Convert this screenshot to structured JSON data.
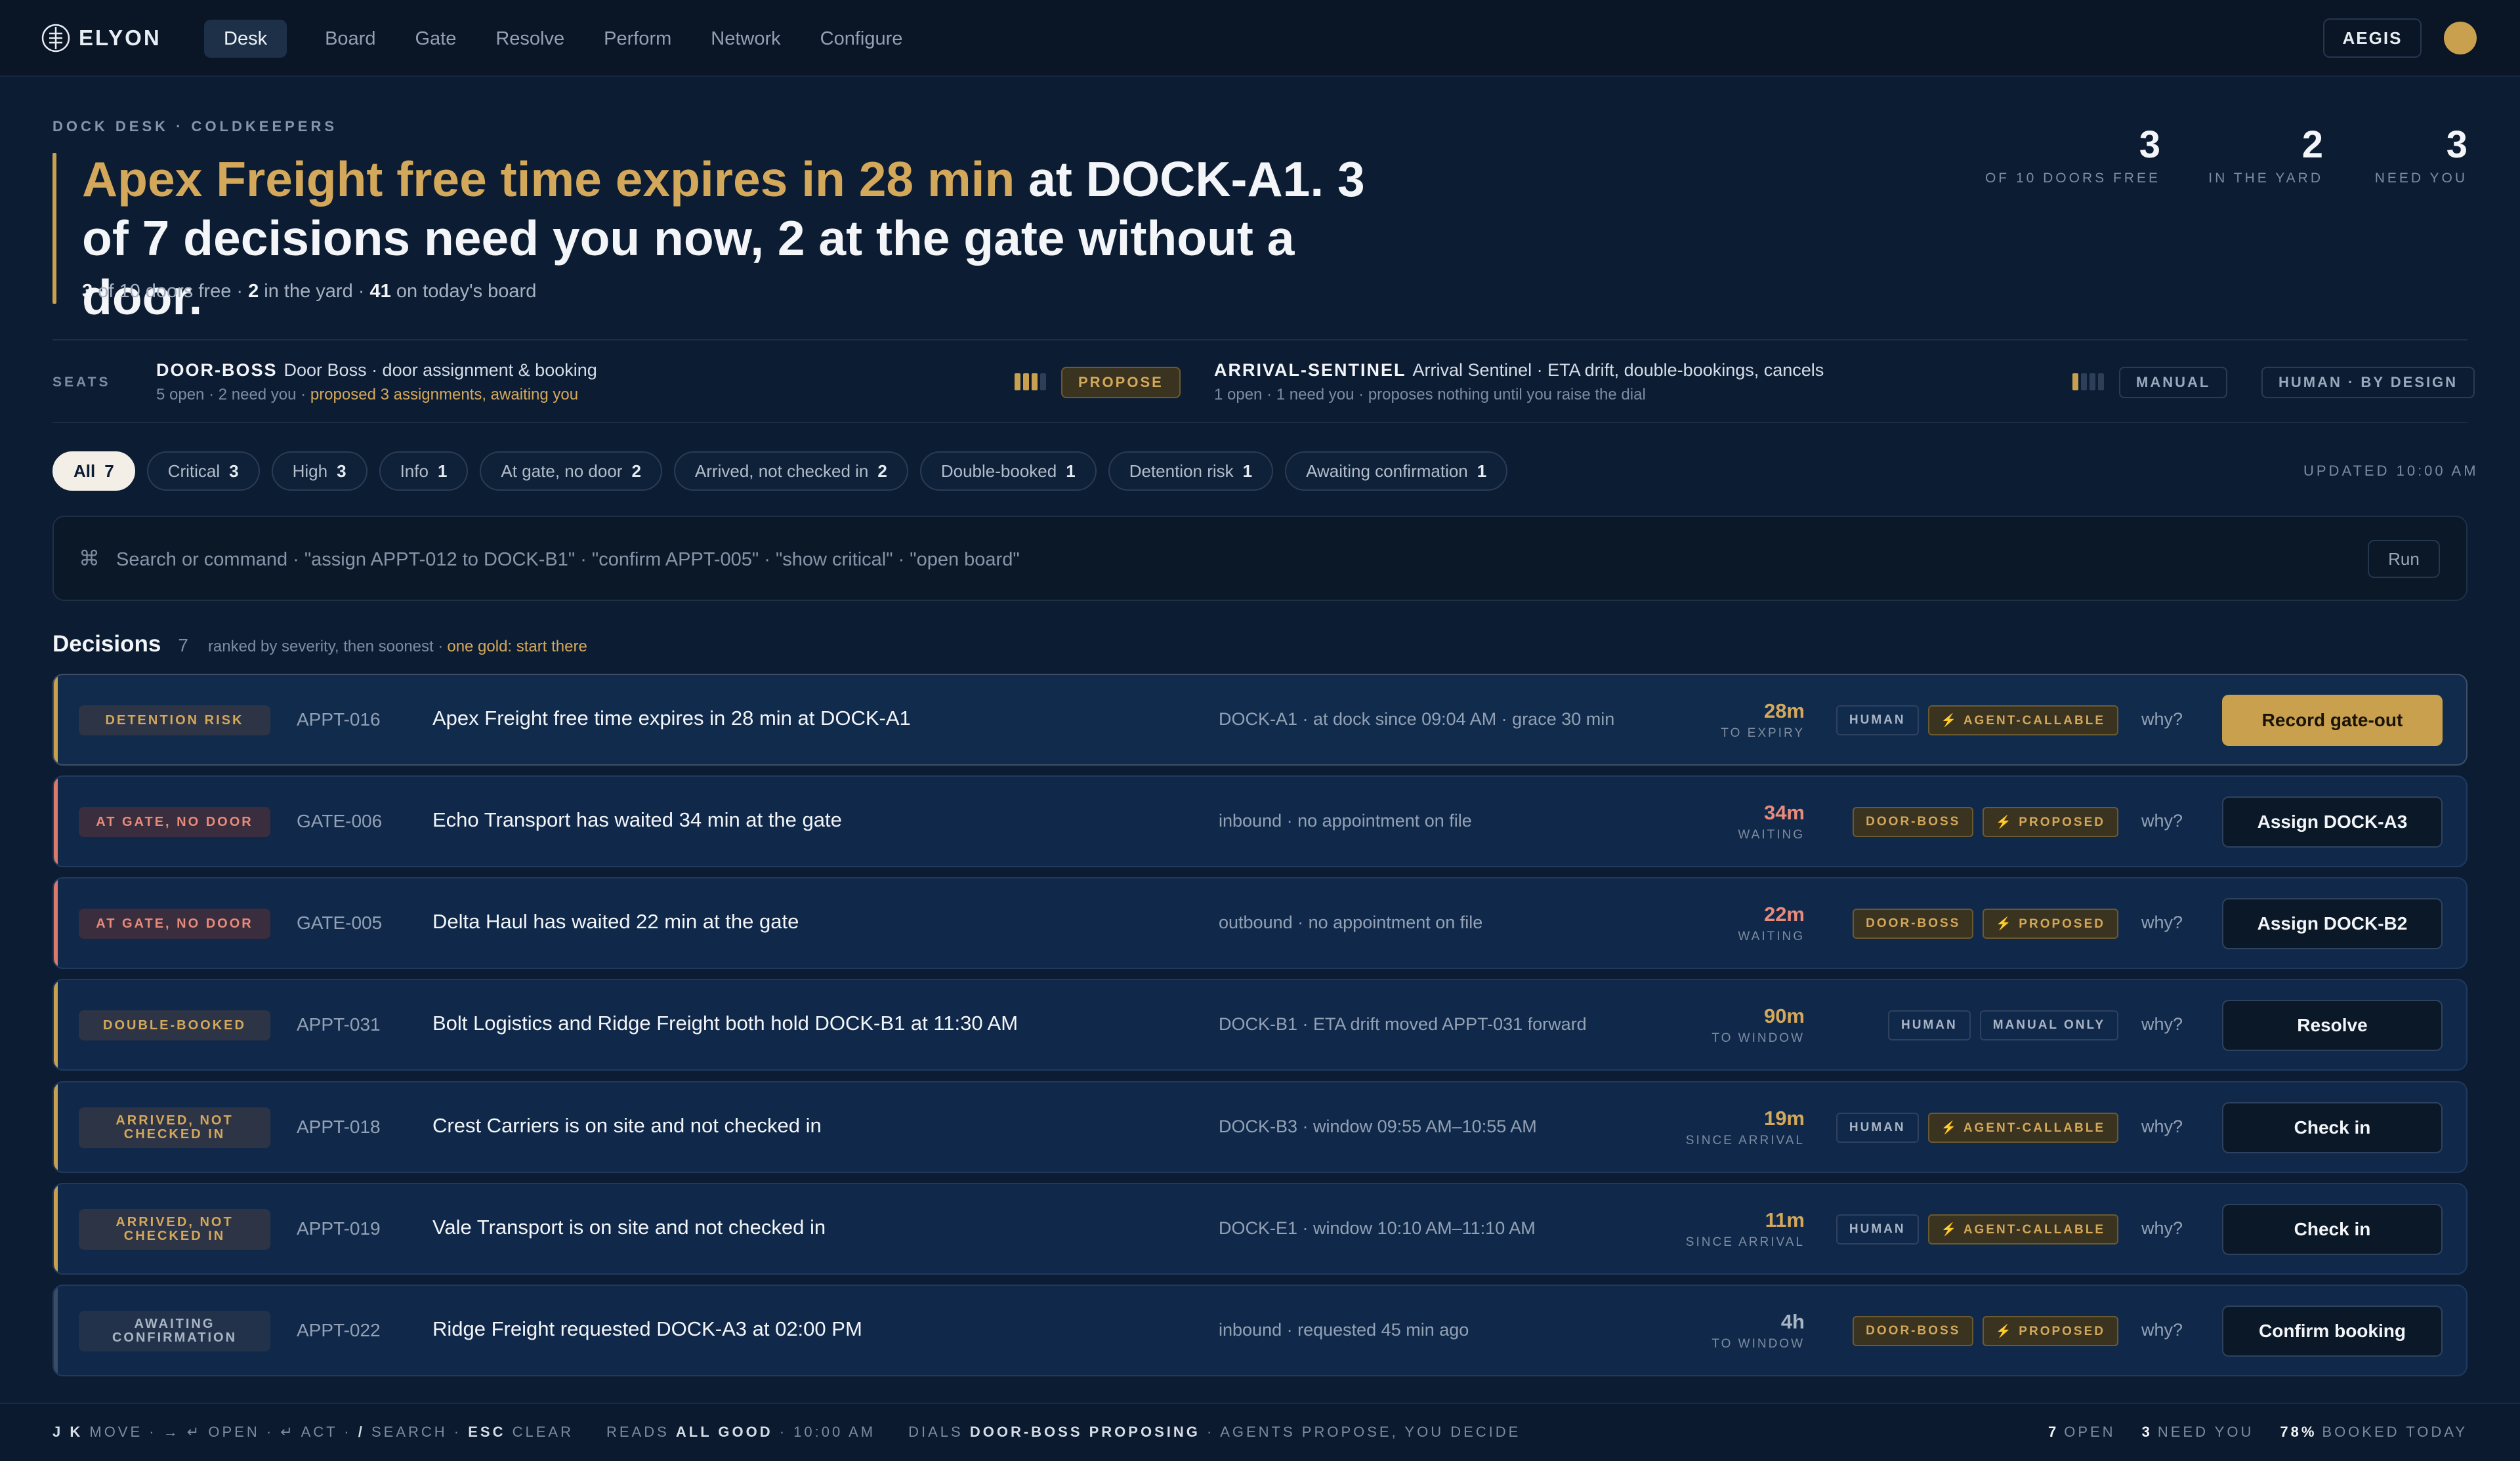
{
  "app": {
    "logo_text": "ELYON",
    "nav": [
      "Desk",
      "Board",
      "Gate",
      "Resolve",
      "Perform",
      "Network",
      "Configure"
    ],
    "active_nav": "Desk",
    "aegis_label": "AEGIS"
  },
  "header": {
    "eyebrow": "DOCK DESK · COLDKEEPERS",
    "headline_gold": "Apex Freight free time expires in 28 min",
    "headline_rest": " at DOCK-A1. 3 of 7 decisions need you now, 2 at the gate without a door.",
    "sub": {
      "free": "3",
      "free_text": " of 10 doors free · ",
      "yard": "2",
      "yard_text": " in the yard · ",
      "board": "41",
      "board_text": " on today's board"
    },
    "stats": [
      {
        "num": "3",
        "label": "OF 10 DOORS FREE"
      },
      {
        "num": "2",
        "label": "IN THE YARD"
      },
      {
        "num": "3",
        "label": "NEED YOU"
      }
    ]
  },
  "seats": {
    "label": "SEATS",
    "items": [
      {
        "code": "DOOR-BOSS",
        "desc": "Door Boss · door assignment & booking",
        "status": "5 open · 2 need you · ",
        "status_gold": "proposed 3 assignments, awaiting you",
        "mode": "PROPOSE",
        "dial": 3
      },
      {
        "code": "ARRIVAL-SENTINEL",
        "desc": "Arrival Sentinel · ETA drift, double-bookings, cancels",
        "status": "1 open · 1 need you · proposes nothing until you raise the dial",
        "status_gold": "",
        "mode": "MANUAL",
        "dial": 1
      }
    ],
    "human_label": "HUMAN · BY DESIGN"
  },
  "filters": [
    {
      "label": "All",
      "count": "7"
    },
    {
      "label": "Critical",
      "count": "3"
    },
    {
      "label": "High",
      "count": "3"
    },
    {
      "label": "Info",
      "count": "1"
    },
    {
      "label": "At gate, no door",
      "count": "2"
    },
    {
      "label": "Arrived, not checked in",
      "count": "2"
    },
    {
      "label": "Double-booked",
      "count": "1"
    },
    {
      "label": "Detention risk",
      "count": "1"
    },
    {
      "label": "Awaiting confirmation",
      "count": "1"
    }
  ],
  "updated": "UPDATED 10:00 AM",
  "search": {
    "icon": "⌘",
    "placeholder": "Search or command · \"assign APPT-012 to DOCK-B1\" · \"confirm APPT-005\" · \"show critical\" · \"open board\"",
    "run_label": "Run"
  },
  "decisions": {
    "title": "Decisions",
    "count": "7",
    "note": "ranked by severity, then soonest ·",
    "note_gold": "one gold: start there",
    "rows": [
      {
        "tag": "DETENTION RISK",
        "id": "APPT-016",
        "title": "Apex Freight free time expires in 28 min at DOCK-A1",
        "meta": "DOCK-A1 · at dock since 09:04 AM · grace 30 min",
        "time": "28m",
        "unit": "TO EXPIRY",
        "badges": [
          "HUMAN",
          "⚡ AGENT-CALLABLE"
        ],
        "why": "why?",
        "action": "Record gate-out"
      },
      {
        "tag": "AT GATE, NO DOOR",
        "id": "GATE-006",
        "title": "Echo Transport has waited 34 min at the gate",
        "meta": "inbound · no appointment on file",
        "time": "34m",
        "unit": "WAITING",
        "badges": [
          "DOOR-BOSS",
          "⚡ PROPOSED"
        ],
        "why": "why?",
        "action": "Assign DOCK-A3"
      },
      {
        "tag": "AT GATE, NO DOOR",
        "id": "GATE-005",
        "title": "Delta Haul has waited 22 min at the gate",
        "meta": "outbound · no appointment on file",
        "time": "22m",
        "unit": "WAITING",
        "badges": [
          "DOOR-BOSS",
          "⚡ PROPOSED"
        ],
        "why": "why?",
        "action": "Assign DOCK-B2"
      },
      {
        "tag": "DOUBLE-BOOKED",
        "id": "APPT-031",
        "title": "Bolt Logistics and Ridge Freight both hold DOCK-B1 at 11:30 AM",
        "meta": "DOCK-B1 · ETA drift moved APPT-031 forward",
        "time": "90m",
        "unit": "TO WINDOW",
        "badges": [
          "HUMAN",
          "MANUAL ONLY"
        ],
        "why": "why?",
        "action": "Resolve"
      },
      {
        "tag": "ARRIVED, NOT CHECKED IN",
        "id": "APPT-018",
        "title": "Crest Carriers is on site and not checked in",
        "meta": "DOCK-B3 · window 09:55 AM–10:55 AM",
        "time": "19m",
        "unit": "SINCE ARRIVAL",
        "badges": [
          "HUMAN",
          "⚡ AGENT-CALLABLE"
        ],
        "why": "why?",
        "action": "Check in"
      },
      {
        "tag": "ARRIVED, NOT CHECKED IN",
        "id": "APPT-019",
        "title": "Vale Transport is on site and not checked in",
        "meta": "DOCK-E1 · window 10:10 AM–11:10 AM",
        "time": "11m",
        "unit": "SINCE ARRIVAL",
        "badges": [
          "HUMAN",
          "⚡ AGENT-CALLABLE"
        ],
        "why": "why?",
        "action": "Check in"
      },
      {
        "tag": "AWAITING CONFIRMATION",
        "id": "APPT-022",
        "title": "Ridge Freight requested DOCK-A3 at 02:00 PM",
        "meta": "inbound · requested 45 min ago",
        "time": "4h",
        "unit": "TO WINDOW",
        "badges": [
          "DOOR-BOSS",
          "⚡ PROPOSED"
        ],
        "why": "why?",
        "action": "Confirm booking"
      }
    ]
  },
  "footer": {
    "keys": "J K",
    "move": " MOVE · → ↵ OPEN · ↵ ACT · ",
    "slash": "/",
    "search": " SEARCH · ",
    "esc": "ESC",
    "clear": " CLEAR",
    "reads": "READS ",
    "reads_b": "ALL GOOD",
    "reads_time": " · 10:00 AM",
    "dials": "DIALS ",
    "dials_b": "DOOR-BOSS PROPOSING",
    "dials_rest": " · AGENTS PROPOSE, YOU DECIDE",
    "open": "7",
    "open_l": "OPEN",
    "need": "3",
    "need_l": "NEED YOU",
    "booked": "78%",
    "booked_l": "BOOKED TODAY"
  },
  "colors": {
    "gold": "#c9a04e",
    "red": "#e88b7a",
    "bg": "#0c1d33"
  }
}
